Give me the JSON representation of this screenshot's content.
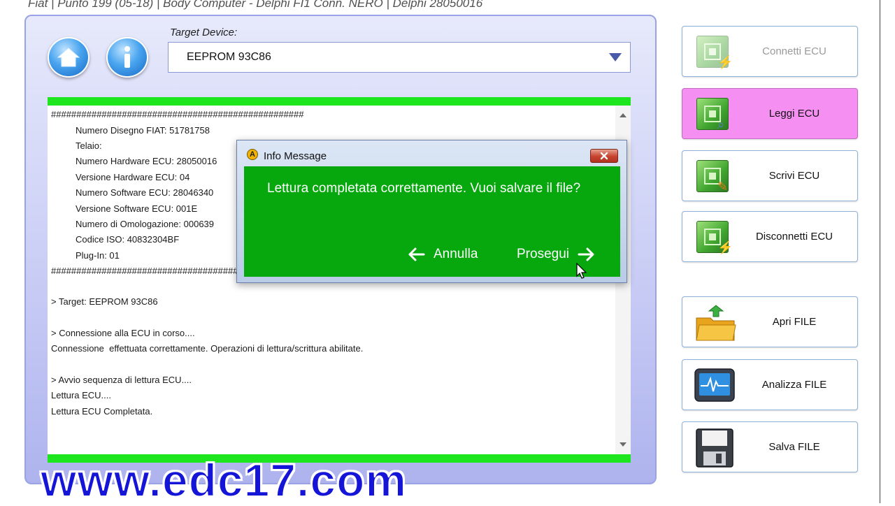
{
  "window": {
    "title": "Fiat | Punto 199 (05-18) | Body Computer - Delphi FI1 Conn. NERO | Delphi 28050016"
  },
  "target": {
    "label": "Target Device:",
    "value": "EEPROM 93C86"
  },
  "log": {
    "separator": "##################################################",
    "info_lines": [
      "Numero Disegno FIAT: 51781758",
      "Telaio:",
      "Numero Hardware ECU: 28050016",
      "Versione Hardware ECU: 04",
      "Numero Software ECU: 28046340",
      "Versione Software ECU: 001E",
      "Numero di Omologazione: 000639",
      "Codice ISO: 40832304BF",
      "Plug-In: 01"
    ],
    "separator_partial": "######################################",
    "lines": [
      "> Target: EEPROM 93C86",
      "> Connessione alla ECU in corso....",
      "Connessione  effettuata correttamente. Operazioni di lettura/scrittura abilitate.",
      "> Avvio sequenza di lettura ECU....",
      "Lettura ECU....",
      "Lettura ECU Completata."
    ]
  },
  "dialog": {
    "title": "Info Message",
    "message": "Lettura completata correttamente. Vuoi salvare il file?",
    "cancel_label": "Annulla",
    "ok_label": "Prosegui"
  },
  "side_buttons": {
    "connect": "Connetti ECU",
    "read": "Leggi ECU",
    "write": "Scrivi ECU",
    "disconnect": "Disconnetti ECU",
    "open_file": "Apri FILE",
    "analyze_file": "Analizza FILE",
    "save_file": "Salva FILE"
  },
  "watermark": "www.edc17.com",
  "colors": {
    "accent_green": "#1ee61e",
    "dialog_green": "#07a80e",
    "active_button": "#f590f2",
    "watermark_blue": "#1515d8"
  }
}
